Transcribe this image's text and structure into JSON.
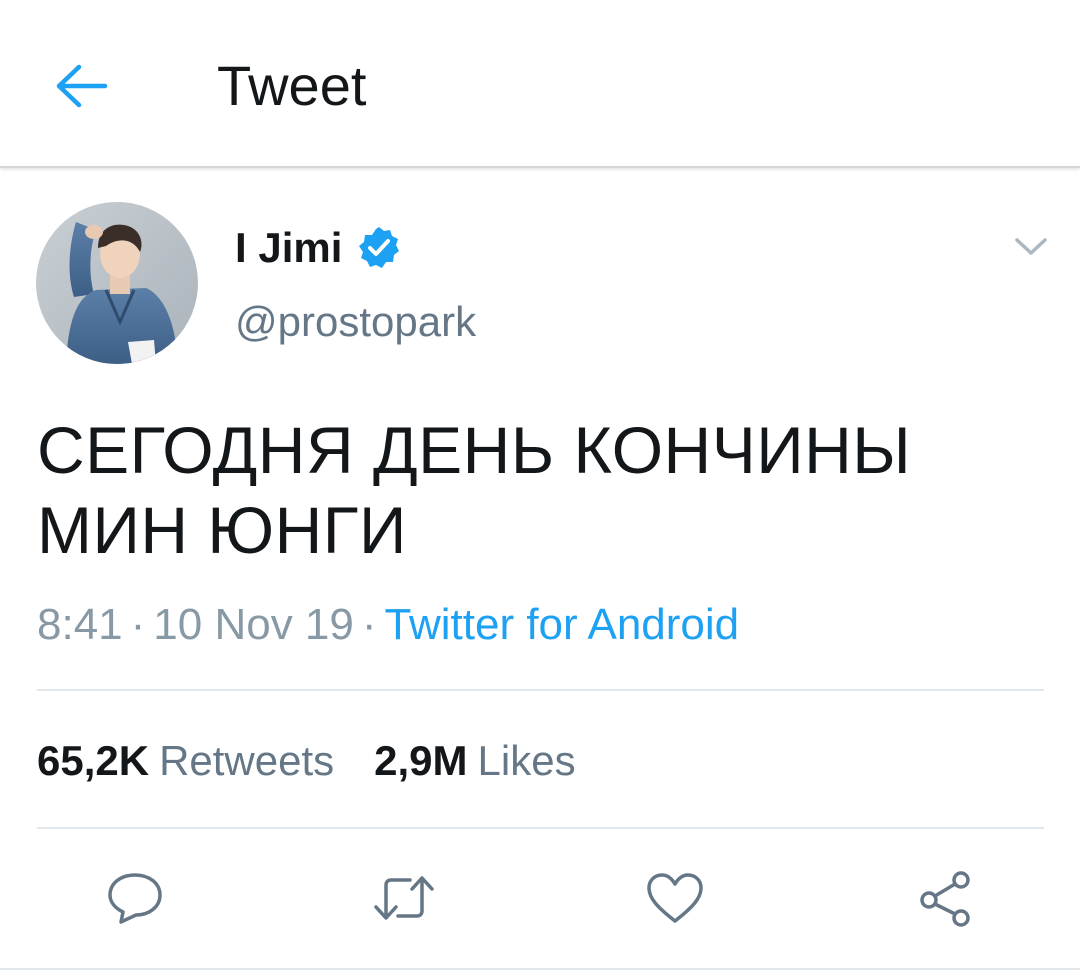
{
  "header": {
    "title": "Tweet",
    "back_icon": "arrow-left-icon"
  },
  "tweet": {
    "author": {
      "name": "I Jimi",
      "handle": "@prostopark",
      "verified": true,
      "avatar": "avatar-photo"
    },
    "text": "СЕГОДНЯ ДЕНЬ КОНЧИНЫ МИН ЮНГИ",
    "time": "8:41",
    "date": "10 Nov 19",
    "separator": "·",
    "source": "Twitter for Android",
    "stats": {
      "retweets_count": "65,2K",
      "retweets_label": "Retweets",
      "likes_count": "2,9M",
      "likes_label": "Likes"
    }
  },
  "actions": [
    {
      "name": "reply",
      "icon": "speech-bubble-icon"
    },
    {
      "name": "retweet",
      "icon": "retweet-icon"
    },
    {
      "name": "like",
      "icon": "heart-icon"
    },
    {
      "name": "share",
      "icon": "share-icon"
    }
  ],
  "colors": {
    "accent": "#1da1f2",
    "text": "#14171a",
    "secondary": "#657786",
    "meta": "#8899a6",
    "divider": "#e1e8ed"
  }
}
